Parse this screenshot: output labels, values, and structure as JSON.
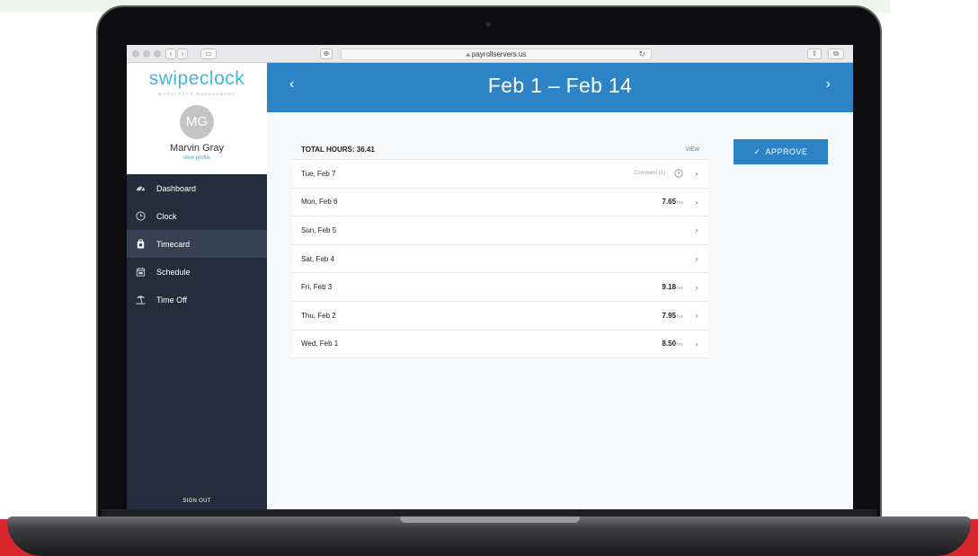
{
  "browser": {
    "url": "payrollservers.us"
  },
  "sidebar": {
    "logo": "swipeclock",
    "logo_tagline": "WORKFORCE MANAGEMENT",
    "avatar_initials": "MG",
    "user_name": "Marvin Gray",
    "view_profile": "view profile",
    "items": [
      {
        "label": "Dashboard",
        "icon": "dashboard-icon"
      },
      {
        "label": "Clock",
        "icon": "clock-icon"
      },
      {
        "label": "Timecard",
        "icon": "timecard-icon",
        "active": true
      },
      {
        "label": "Schedule",
        "icon": "calendar-icon"
      },
      {
        "label": "Time Off",
        "icon": "beach-icon"
      }
    ],
    "sign_out": "SIGN OUT"
  },
  "header": {
    "prev": "‹",
    "period": "Feb 1 – Feb 14",
    "next": "›"
  },
  "timecard": {
    "total_hours": "TOTAL HOURS: 36.41",
    "view": "VIEW",
    "hrs_unit": "hrs",
    "days": [
      {
        "day": "Tue, Feb 7",
        "hours": "",
        "comment": "Comment (1)"
      },
      {
        "day": "Mon, Feb 6",
        "hours": "7.65",
        "comment": ""
      },
      {
        "day": "Sun, Feb 5",
        "hours": "",
        "comment": ""
      },
      {
        "day": "Sat, Feb 4",
        "hours": "",
        "comment": ""
      },
      {
        "day": "Fri, Feb 3",
        "hours": "9.18",
        "comment": ""
      },
      {
        "day": "Thu, Feb 2",
        "hours": "7.95",
        "comment": ""
      },
      {
        "day": "Wed, Feb 1",
        "hours": "8.50",
        "comment": ""
      }
    ],
    "approve": "APPROVE"
  },
  "colors": {
    "accent": "#2c83c5",
    "sidebar": "#232d3b",
    "brand": "#41b6e6"
  }
}
